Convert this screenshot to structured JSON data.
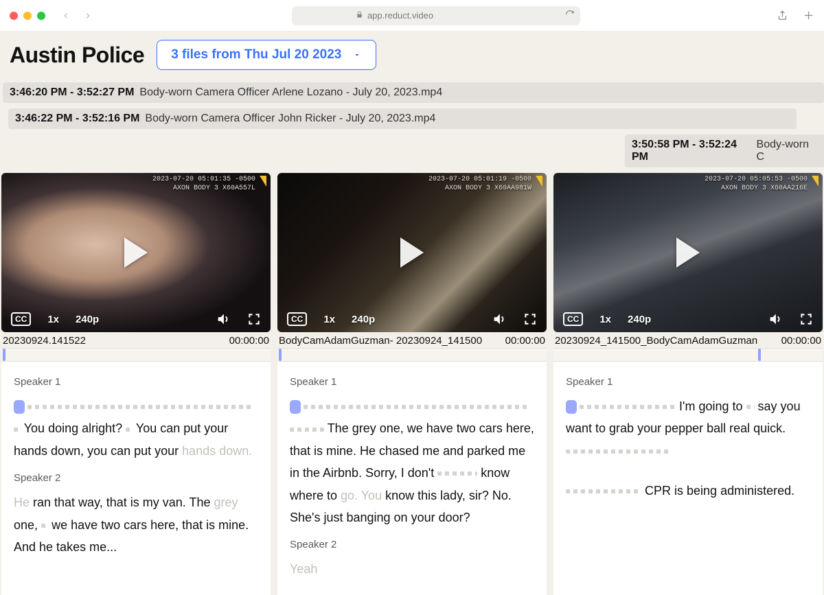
{
  "browser": {
    "url": "app.reduct.video"
  },
  "header": {
    "title": "Austin Police",
    "pill_label": "3 files from Thu Jul 20 2023"
  },
  "file_bars": [
    {
      "time": "3:46:20 PM - 3:52:27 PM",
      "name": "Body-worn Camera Officer Arlene Lozano - July 20, 2023.mp4"
    },
    {
      "time": "3:46:22 PM - 3:52:16 PM",
      "name": "Body-worn Camera Officer John Ricker - July 20, 2023.mp4"
    },
    {
      "time": "3:50:58 PM - 3:52:24 PM",
      "name": "Body-worn C"
    }
  ],
  "video_controls": {
    "cc": "CC",
    "speed": "1x",
    "quality": "240p"
  },
  "panels": [
    {
      "stamp_line1": "2023-07-20  05:01:35 -0500",
      "stamp_line2": "AXON BODY 3  X60A557L",
      "meta_left": "20230924.141522",
      "meta_right": "00:00:00",
      "speaker1": "Speaker 1",
      "s1_a": "You doing alright?",
      "s1_b": "You can put your hands down, you can put your ",
      "s1_c": "hands down.",
      "speaker2": "Speaker 2",
      "s2_a": "He",
      "s2_b": " ran that way, that is my van. The ",
      "s2_c": "grey",
      "s2_d": " one,",
      "s2_e": " we have two cars here, that is mine. And he takes me..."
    },
    {
      "stamp_line1": "2023-07-20  05:01:19 -0500",
      "stamp_line2": "AXON BODY 3  X60AA981W",
      "meta_left": "BodyCamAdamGuzman- 20230924_141500",
      "meta_right": "00:00:00",
      "speaker1": "Speaker 1",
      "s1_a": "The grey one, we have two cars here, that is mine. He chased me and parked me in the Airbnb. Sorry, I don't",
      "s1_b": " know where to ",
      "s1_c": "go. You",
      "s1_d": " know this lady, sir? No. She's just banging on your door?",
      "speaker2": "Speaker 2",
      "s2_a": "Yeah"
    },
    {
      "stamp_line1": "2023-07-20  05:05:53 -0500",
      "stamp_line2": "AXON BODY 3  X60AA216E",
      "meta_left": "20230924_141500_BodyCamAdamGuzman",
      "meta_right": "00:00:00",
      "speaker1": "Speaker 1",
      "s1_a": "I'm going to",
      "s1_b": " say you want to grab your pepper ball real quick.",
      "s1_c": "CPR is being administered."
    }
  ]
}
